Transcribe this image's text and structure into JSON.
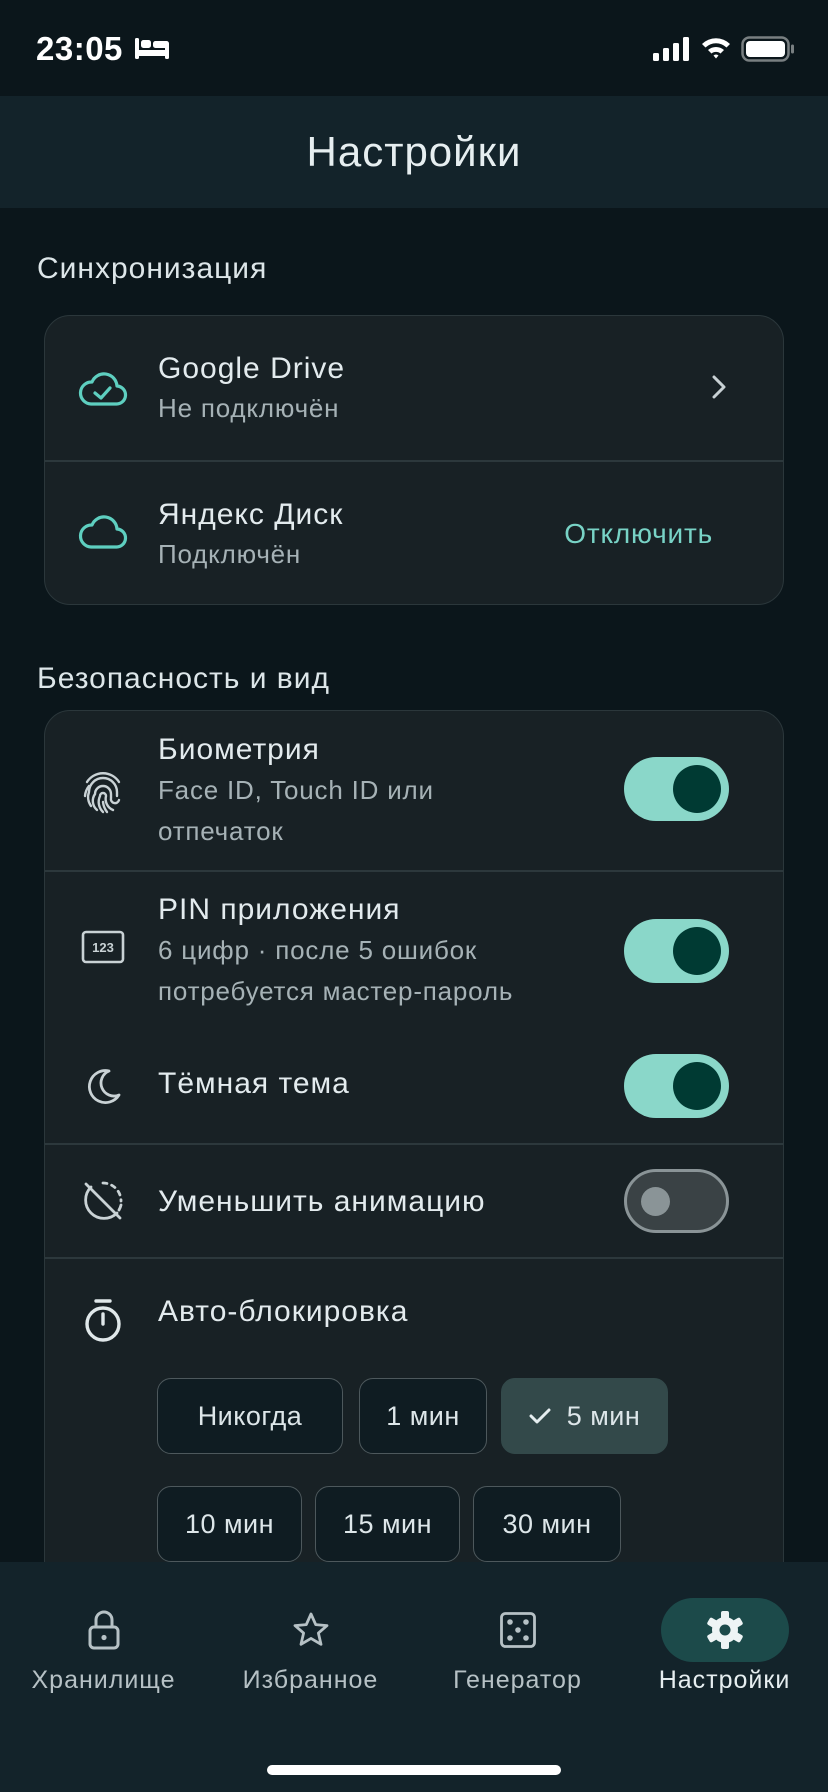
{
  "status_bar": {
    "time": "23:05"
  },
  "header": {
    "title": "Настройки"
  },
  "sync": {
    "title": "Синхронизация",
    "items": [
      {
        "title": "Google Drive",
        "subtitle": "Не подключён",
        "icon": "cloud-check-icon"
      },
      {
        "title": "Яндекс Диск",
        "subtitle": "Подключён",
        "action": "Отключить",
        "icon": "cloud-icon"
      }
    ]
  },
  "security": {
    "title": "Безопасность и вид",
    "biometry": {
      "title": "Биометрия",
      "subtitle_1": "Face ID, Touch ID или",
      "subtitle_2": "отпечаток",
      "enabled": true
    },
    "pin": {
      "title": "PIN приложения",
      "subtitle_1": "6 цифр · после 5 ошибок",
      "subtitle_2": "потребуется мастер-пароль",
      "enabled": true
    },
    "dark_theme": {
      "title": "Тёмная тема",
      "enabled": true
    },
    "reduce_motion": {
      "title": "Уменьшить анимацию",
      "enabled": false
    },
    "autolock": {
      "title": "Авто-блокировка",
      "options": [
        "Никогда",
        "1 мин",
        "5 мин",
        "10 мин",
        "15 мин",
        "30 мин"
      ],
      "selected": "5 мин"
    }
  },
  "nav": {
    "items": [
      {
        "label": "Хранилище",
        "icon": "lock-icon"
      },
      {
        "label": "Избранное",
        "icon": "star-icon"
      },
      {
        "label": "Генератор",
        "icon": "dice-icon"
      },
      {
        "label": "Настройки",
        "icon": "gear-icon"
      }
    ],
    "active": "Настройки"
  },
  "colors": {
    "accent": "#78d3c6",
    "toggle_on": "#8ad7c9",
    "background": "#0b161b",
    "card": "#182125"
  }
}
